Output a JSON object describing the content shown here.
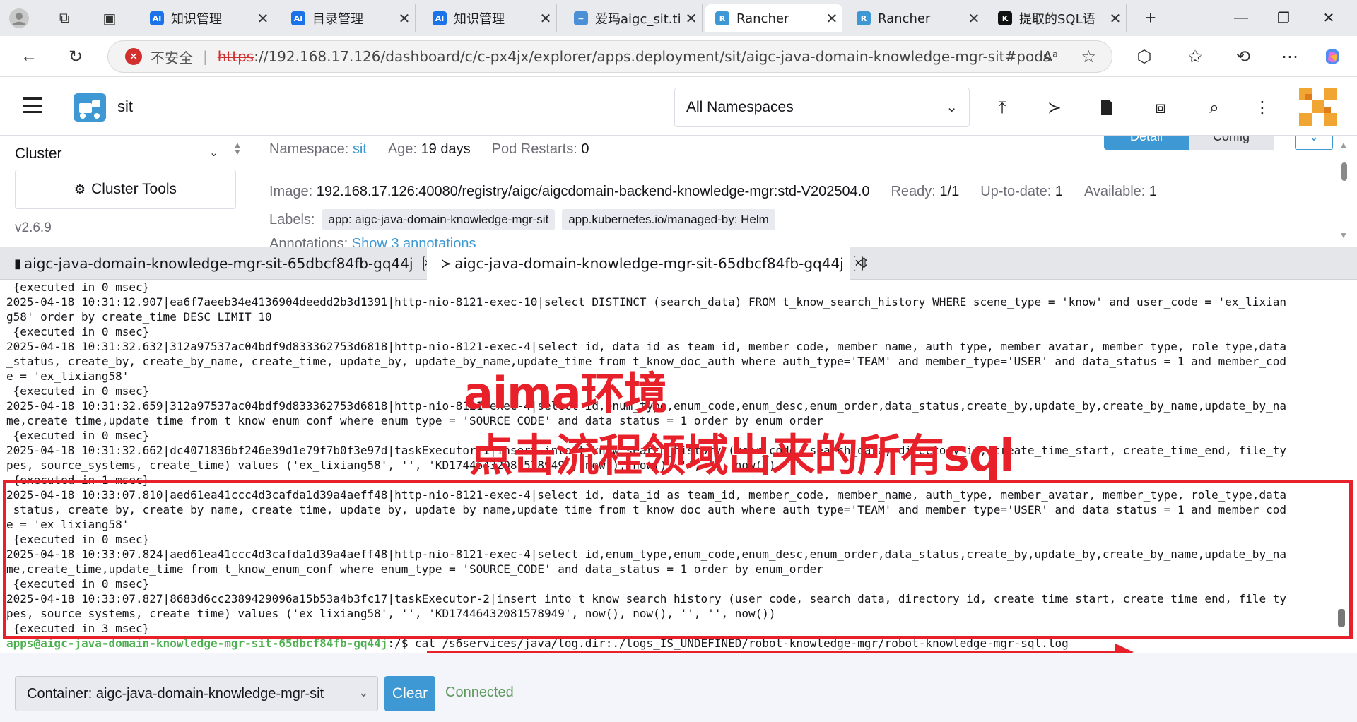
{
  "browser": {
    "tabs": [
      {
        "title": "知识管理",
        "favicon": "AI",
        "fav_color": "#1a73e8"
      },
      {
        "title": "目录管理",
        "favicon": "AI",
        "fav_color": "#1a73e8"
      },
      {
        "title": "知识管理",
        "favicon": "AI",
        "fav_color": "#1a73e8"
      },
      {
        "title": "爱玛aigc_sit.ti",
        "favicon": "~",
        "fav_color": "#4b8fd6"
      },
      {
        "title": "Rancher",
        "favicon": "R",
        "fav_color": "#3d98d3"
      },
      {
        "title": "Rancher",
        "favicon": "R",
        "fav_color": "#3d98d3"
      },
      {
        "title": "提取的SQL语",
        "favicon": "K",
        "fav_color": "#111111"
      }
    ],
    "new_tab": "+",
    "insecure_label": "不安全",
    "url_scheme": "https",
    "url_rest": "://192.168.17.126/dashboard/c/c-px4jx/explorer/apps.deployment/sit/aigc-java-domain-knowledge-mgr-sit#pods"
  },
  "header": {
    "cluster_name": "sit",
    "namespace_select": "All Namespaces",
    "icons": [
      "upload-icon",
      "shell-icon",
      "file-icon",
      "copy-config-icon",
      "search-icon",
      "more-icon"
    ]
  },
  "sidenav": {
    "cluster_label": "Cluster",
    "tools_label": "Cluster Tools",
    "version": "v2.6.9"
  },
  "details": {
    "namespace_label": "Namespace:",
    "namespace_value": "sit",
    "age_label": "Age:",
    "age_value": "19 days",
    "restarts_label": "Pod Restarts:",
    "restarts_value": "0",
    "image_label": "Image:",
    "image_value": "192.168.17.126:40080/registry/aigc/aigcdomain-backend-knowledge-mgr:std-V202504.0",
    "ready_label": "Ready:",
    "ready_value": "1/1",
    "uptodate_label": "Up-to-date:",
    "uptodate_value": "1",
    "available_label": "Available:",
    "available_value": "1",
    "labels_label": "Labels:",
    "labels": [
      "app: aigc-java-domain-knowledge-mgr-sit",
      "app.kubernetes.io/managed-by: Helm"
    ],
    "annotations_label": "Annotations:",
    "annotations_link": "Show 3 annotations",
    "btn_detail": "Detail",
    "btn_config": "Config"
  },
  "shell_tabs": [
    {
      "icon": "file-icon",
      "label": "aigc-java-domain-knowledge-mgr-sit-65dbcf84fb-gq44j"
    },
    {
      "icon": "shell-icon",
      "label": "aigc-java-domain-knowledge-mgr-sit-65dbcf84fb-gq44j"
    }
  ],
  "terminal": {
    "lines": [
      " {executed in 0 msec}",
      "2025-04-18 10:31:12.907|ea6f7aeeb34e4136904deedd2b3d1391|http-nio-8121-exec-10|select DISTINCT (search_data) FROM t_know_search_history WHERE scene_type = 'know' and user_code = 'ex_lixian",
      "g58' order by create_time DESC LIMIT 10",
      " {executed in 0 msec}",
      "2025-04-18 10:31:32.632|312a97537ac04bdf9d833362753d6818|http-nio-8121-exec-4|select id, data_id as team_id, member_code, member_name, auth_type, member_avatar, member_type, role_type,data",
      "_status, create_by, create_by_name, create_time, update_by, update_by_name,update_time from t_know_doc_auth where auth_type='TEAM' and member_type='USER' and data_status = 1 and member_cod",
      "e = 'ex_lixiang58'",
      " {executed in 0 msec}",
      "2025-04-18 10:31:32.659|312a97537ac04bdf9d833362753d6818|http-nio-8121-exec-4|select id,enum_type,enum_code,enum_desc,enum_order,data_status,create_by,update_by,create_by_name,update_by_na",
      "me,create_time,update_time from t_know_enum_conf where enum_type = 'SOURCE_CODE' and data_status = 1 order by enum_order",
      " {executed in 0 msec}",
      "2025-04-18 10:31:32.662|dc4071836bf246e39d1e79f7b0f3e97d|taskExecutor-1|insert into t_know_search_history (user_code, search_data, directory_id, create_time_start, create_time_end, file_ty",
      "pes, source_systems, create_time) values ('ex_lixiang58', '', 'KD17446432081578949', now(), now(), '', '', now())",
      " {executed in 1 msec}",
      "2025-04-18 10:33:07.810|aed61ea41ccc4d3cafda1d39a4aeff48|http-nio-8121-exec-4|select id, data_id as team_id, member_code, member_name, auth_type, member_avatar, member_type, role_type,data",
      "_status, create_by, create_by_name, create_time, update_by, update_by_name,update_time from t_know_doc_auth where auth_type='TEAM' and member_type='USER' and data_status = 1 and member_cod",
      "e = 'ex_lixiang58'",
      " {executed in 0 msec}",
      "2025-04-18 10:33:07.824|aed61ea41ccc4d3cafda1d39a4aeff48|http-nio-8121-exec-4|select id,enum_type,enum_code,enum_desc,enum_order,data_status,create_by,update_by,create_by_name,update_by_na",
      "me,create_time,update_time from t_know_enum_conf where enum_type = 'SOURCE_CODE' and data_status = 1 order by enum_order",
      " {executed in 0 msec}",
      "2025-04-18 10:33:07.827|8683d6cc2389429096a15b53a4b3fc17|taskExecutor-2|insert into t_know_search_history (user_code, search_data, directory_id, create_time_start, create_time_end, file_ty",
      "pes, source_systems, create_time) values ('ex_lixiang58', '', 'KD17446432081578949', now(), now(), '', '', now())",
      " {executed in 3 msec}"
    ],
    "prompt_user": "apps@aigc-java-domain-knowledge-mgr-sit-65dbcf84fb-gq44j",
    "prompt_path": ":/$ ",
    "command": "cat /s6services/java/log.dir:./logs_IS_UNDEFINED/robot-knowledge-mgr/robot-knowledge-mgr-sql.log"
  },
  "annotation": {
    "line1": "aima环境",
    "line2": "点击流程领域出来的所有sql",
    "color": "#e8202a"
  },
  "footer": {
    "container_select": "Container: aigc-java-domain-knowledge-mgr-sit",
    "clear_label": "Clear",
    "status": "Connected"
  },
  "colors": {
    "accent": "#3d98d3",
    "connected": "#5d995d",
    "prompt": "#4caf50"
  }
}
